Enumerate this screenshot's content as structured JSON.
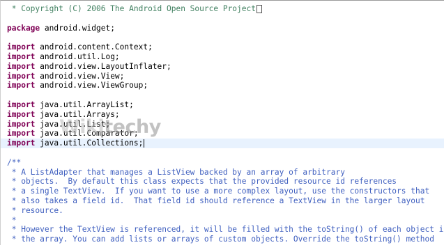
{
  "code": {
    "copyright": " * Copyright (C) 2006 The Android Open Source Project",
    "package_kw": "package",
    "package_name": " android.widget;",
    "imports_android": [
      " android.content.Context;",
      " android.util.Log;",
      " android.view.LayoutInflater;",
      " android.view.View;",
      " android.view.ViewGroup;"
    ],
    "imports_java": [
      " java.util.ArrayList;",
      " java.util.Arrays;",
      " java.util.List;",
      " java.util.Comparator;",
      " java.util.Collections;"
    ],
    "import_kw": "import",
    "javadoc": [
      "/**",
      " * A ListAdapter that manages a ListView backed by an array of arbitrary",
      " * objects.  By default this class expects that the provided resource id references",
      " * a single TextView.  If you want to use a more complex layout, use the constructors that",
      " * also takes a field id.  That field id should reference a TextView in the larger layout",
      " * resource.",
      " *",
      " * However the TextView is referenced, it will be filled with the toString() of each object in",
      " * the array. You can add lists or arrays of custom objects. Override the toString() method"
    ]
  },
  "watermark": {
    "part1": "Wiki",
    "part2": "techy"
  }
}
